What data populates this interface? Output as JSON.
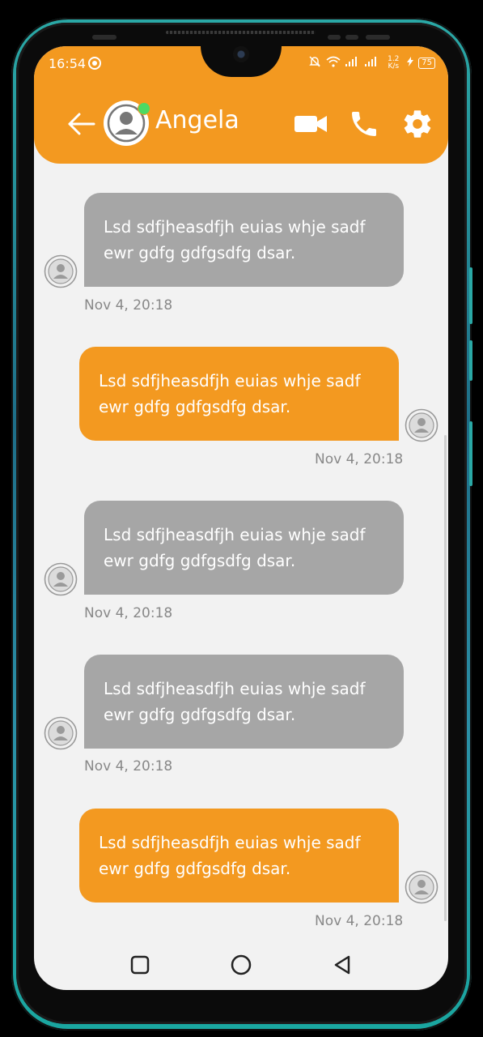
{
  "status_bar": {
    "time": "16:54",
    "network_speed": "1.2 K/s",
    "battery": "75"
  },
  "header": {
    "contact_name": "Angela",
    "online": true,
    "icons": [
      "back-arrow-icon",
      "video-call-icon",
      "phone-icon",
      "gear-icon"
    ]
  },
  "messages": [
    {
      "direction": "incoming",
      "text_line1": "Lsd sdfjheasdfjh euias whje sadf",
      "text_line2": "ewr gdfg gdfgsdfg dsar.",
      "timestamp": "Nov 4, 20:18"
    },
    {
      "direction": "outgoing",
      "text_line1": "Lsd sdfjheasdfjh euias whje sadf",
      "text_line2": "ewr gdfg gdfgsdfg dsar.",
      "timestamp": "Nov 4, 20:18"
    },
    {
      "direction": "incoming",
      "text_line1": "Lsd sdfjheasdfjh euias whje sadf",
      "text_line2": "ewr gdfg gdfgsdfg dsar.",
      "timestamp": "Nov 4, 20:18"
    },
    {
      "direction": "incoming",
      "text_line1": "Lsd sdfjheasdfjh euias whje sadf",
      "text_line2": "ewr gdfg gdfgsdfg dsar.",
      "timestamp": "Nov 4, 20:18"
    },
    {
      "direction": "outgoing",
      "text_line1": "Lsd sdfjheasdfjh euias whje sadf",
      "text_line2": "ewr gdfg gdfgsdfg dsar.",
      "timestamp": "Nov 4, 20:18"
    }
  ],
  "colors": {
    "accent": "#f39920",
    "incoming_bubble": "#a6a6a6",
    "background": "#f2f2f2",
    "online": "#4cd964"
  },
  "nav_bar": {
    "icons": [
      "recents-square-icon",
      "home-circle-icon",
      "back-triangle-icon"
    ]
  }
}
